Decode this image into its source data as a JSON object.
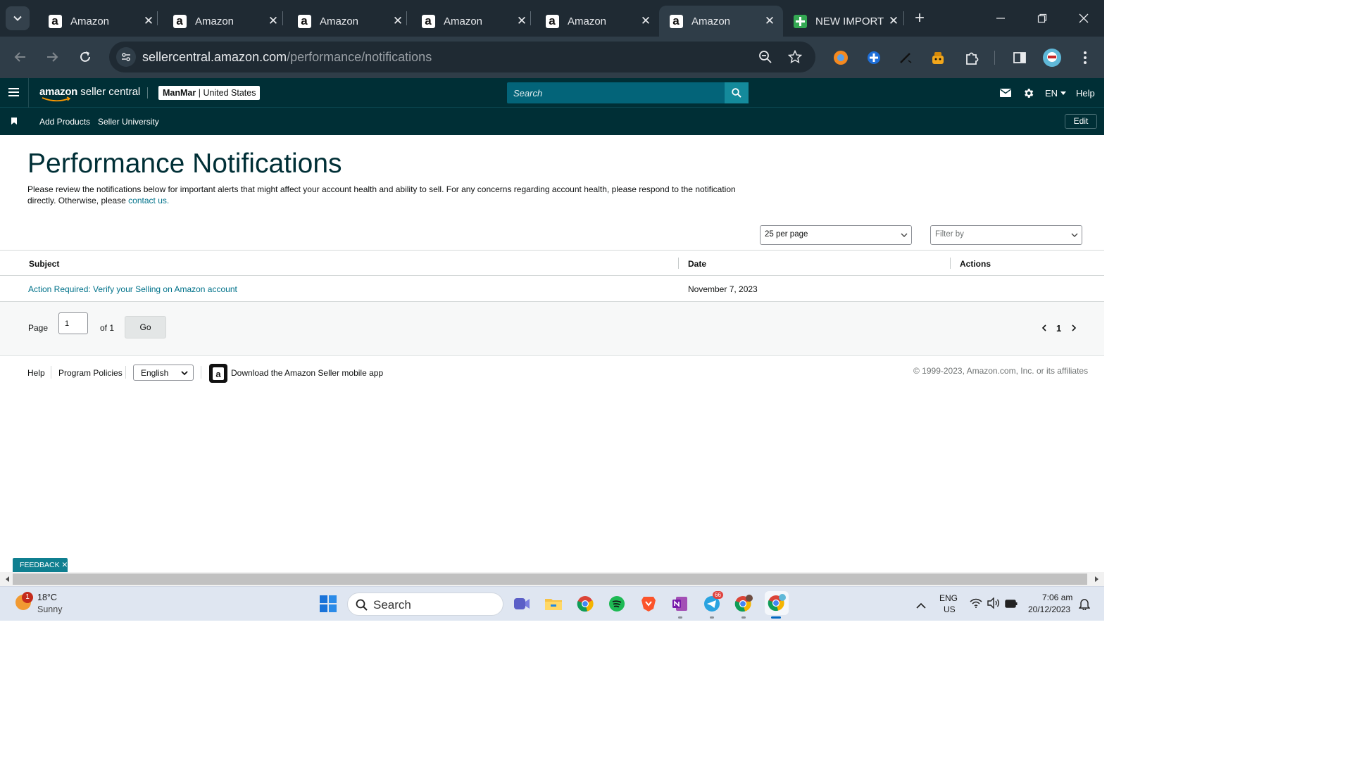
{
  "browser": {
    "tabs": [
      {
        "title": "Amazon",
        "icon": "amazon-a-icon",
        "active": false
      },
      {
        "title": "Amazon",
        "icon": "amazon-a-icon",
        "active": false
      },
      {
        "title": "Amazon",
        "icon": "amazon-a-icon",
        "active": false
      },
      {
        "title": "Amazon",
        "icon": "amazon-a-icon",
        "active": false
      },
      {
        "title": "Amazon",
        "icon": "amazon-a-icon",
        "active": false
      },
      {
        "title": "Amazon",
        "icon": "amazon-a-icon",
        "active": true
      },
      {
        "title": "NEW IMPORT",
        "icon": "sheets-icon",
        "active": false
      }
    ],
    "url_host": "sellercentral.amazon.com",
    "url_path": "/performance/notifications"
  },
  "seller_central": {
    "logo_brand": "amazon",
    "logo_suffix": " seller central",
    "account_name": "ManMar",
    "account_separator": " | ",
    "account_marketplace": "United States",
    "search_placeholder": "Search",
    "language": "EN",
    "help_label": "Help",
    "bookmarks": [
      "Add Products",
      "Seller University"
    ],
    "edit_label": "Edit"
  },
  "page": {
    "title": "Performance Notifications",
    "intro_text": "Please review the notifications below for important alerts that might affect your account health and ability to sell. For any concerns regarding account health, please respond to the notification directly. Otherwise, please ",
    "intro_link": "contact us.",
    "per_page_value": "25 per page",
    "filter_placeholder": "Filter by"
  },
  "table": {
    "columns": {
      "subject": "Subject",
      "date": "Date",
      "actions": "Actions"
    },
    "rows": [
      {
        "subject": "Action Required: Verify your Selling on Amazon account",
        "date": "November 7, 2023",
        "actions": ""
      }
    ]
  },
  "pagination": {
    "page_label": "Page",
    "current_page": "1",
    "of_label": "of 1",
    "go_label": "Go",
    "page_number": "1"
  },
  "footer": {
    "help": "Help",
    "program_policies": "Program Policies",
    "language_value": "English",
    "download_app": "Download the Amazon Seller mobile app",
    "copyright": "© 1999-2023, Amazon.com, Inc. or its affiliates"
  },
  "feedback_label": "FEEDBACK",
  "taskbar": {
    "weather_badge": "1",
    "temperature": "18°C",
    "condition": "Sunny",
    "search_label": "Search",
    "telegram_badge": "66",
    "lang_top": "ENG",
    "lang_bottom": "US",
    "time": "7:06 am",
    "date": "20/12/2023"
  },
  "colors": {
    "header_bg": "#002f36",
    "link": "#00728a",
    "search_button": "#148a9b",
    "browser_frame": "#1f2a33"
  }
}
